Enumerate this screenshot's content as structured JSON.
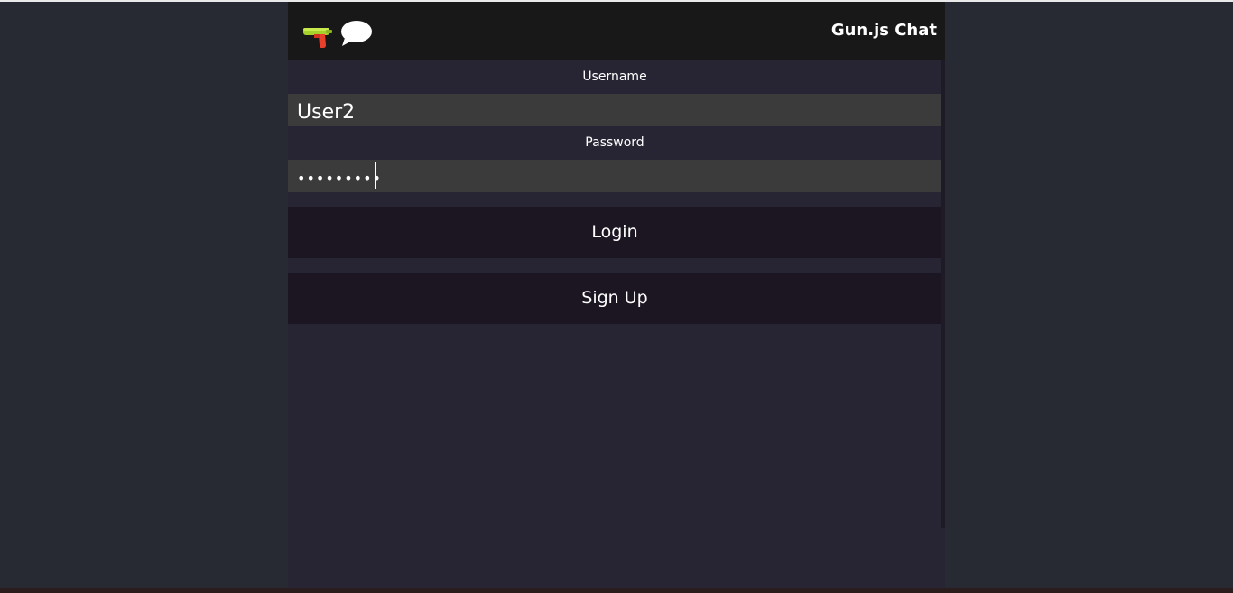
{
  "header": {
    "title": "Gun.js Chat",
    "icons": [
      "water-gun-icon",
      "speech-bubble-icon"
    ]
  },
  "form": {
    "username_label": "Username",
    "username_value": "User2",
    "password_label": "Password",
    "password_value": "•••••••••"
  },
  "buttons": {
    "login_label": "Login",
    "signup_label": "Sign Up"
  },
  "colors": {
    "page_background": "#272a33",
    "app_background": "#272433",
    "header_background": "#181818",
    "input_background": "#3b3b3b",
    "button_background": "#1c1622",
    "text": "#ffffff"
  }
}
